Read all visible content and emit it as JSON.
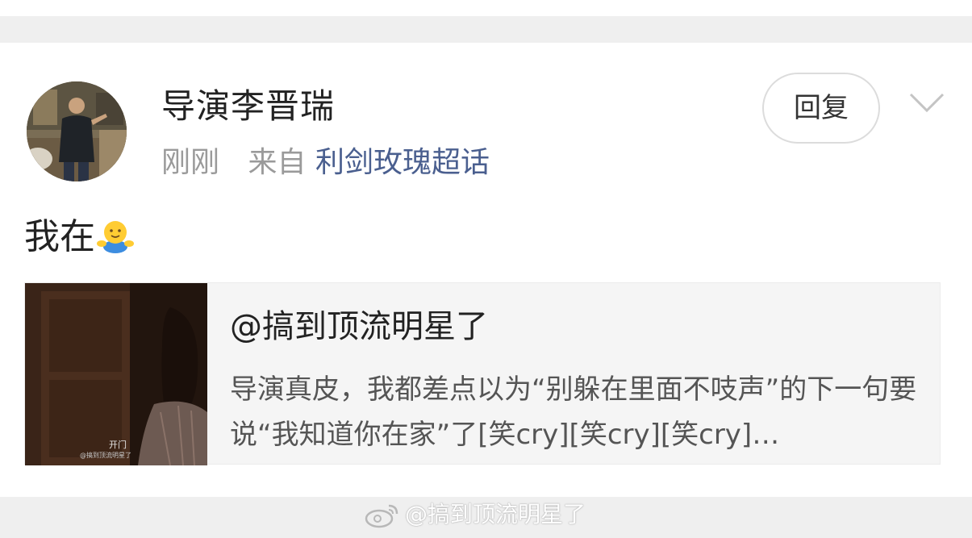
{
  "comment": {
    "username": "导演李晋瑞",
    "time": "刚刚",
    "source_prefix": "来自",
    "source_name": "利剑玫瑰超话",
    "reply_label": "回复",
    "text": "我在",
    "emoji_icon": "hug-emoji-icon"
  },
  "repost": {
    "title": "@搞到顶流明星了",
    "description": "导演真皮，我都差点以为“别躲在里面不吱声”的下一句要说“我知道你在家”了[笑cry][笑cry][笑cry]…",
    "thumbnail_caption": "开门",
    "thumbnail_watermark": "@搞到顶流明星了"
  },
  "watermark": {
    "text": "@搞到顶流明星了",
    "icon": "weibo-logo-icon"
  },
  "colors": {
    "band": "#efefef",
    "link": "#4a5f8f",
    "card_bg": "#f5f5f5"
  }
}
